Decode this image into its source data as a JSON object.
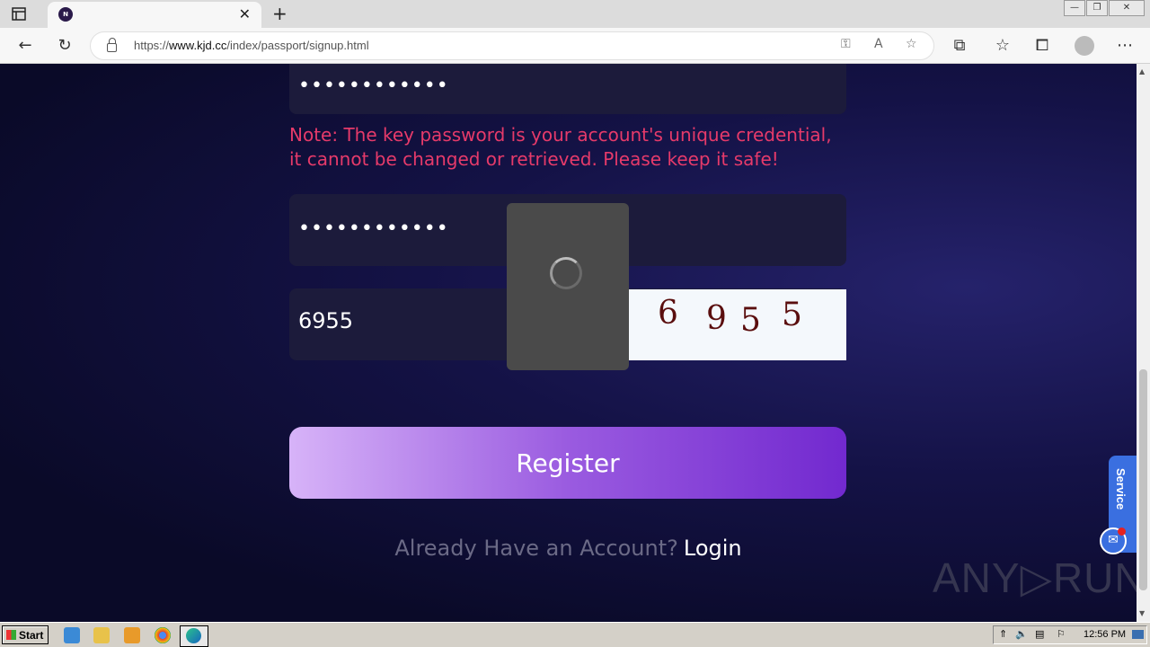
{
  "browser": {
    "tab_title": "",
    "tab_favicon_letter": "N",
    "url_prefix": "https://",
    "url_host": "www.kjd.cc",
    "url_path": "/index/passport/signup.html"
  },
  "form": {
    "key_password_value": "••••••••••••",
    "note": "Note: The key password is your account's unique credential, it cannot be changed or retrieved. Please keep it safe!",
    "confirm_key_password_value": "••••••••••••",
    "captcha_input_value": "6955",
    "captcha_digits": [
      "6",
      "9",
      "5",
      "5"
    ],
    "register_label": "Register",
    "already_text": "Already Have an Account?",
    "login_label": "Login"
  },
  "widgets": {
    "service_label": "Service",
    "watermark": "ANY▷RUN"
  },
  "taskbar": {
    "start_label": "Start",
    "clock": "12:56 PM"
  },
  "colors": {
    "note": "#e63a6a",
    "register_start": "#d7b3f8",
    "register_end": "#7229cf",
    "service": "#3a6fe0"
  }
}
